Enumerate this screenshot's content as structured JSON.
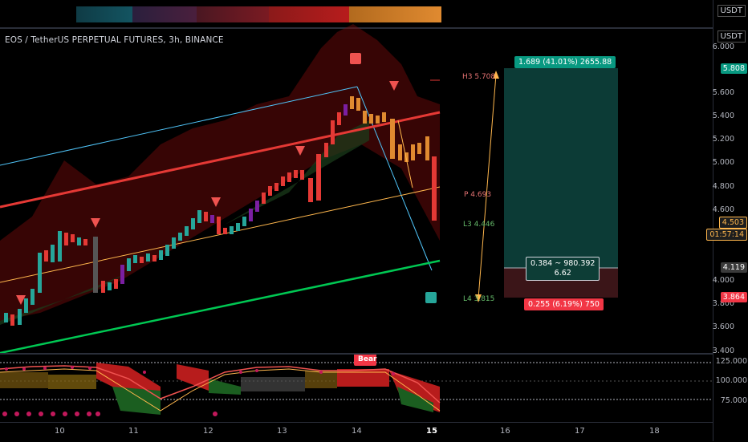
{
  "header": {
    "symbol_title": "EOS / TetherUS PERPETUAL FUTURES, 3h, BINANCE",
    "currency_top": "USDT",
    "currency_main": "USDT"
  },
  "price_axis": {
    "labels": [
      "6.000",
      "5.600",
      "5.400",
      "5.200",
      "5.000",
      "4.800",
      "4.600",
      "4.000",
      "3.800",
      "3.600",
      "3.400"
    ],
    "tags": {
      "target": "5.808",
      "current": "4.503",
      "countdown": "01:57:14",
      "entry": "4.119",
      "stop": "3.864"
    }
  },
  "oscillator_axis": {
    "labels": [
      "125.000",
      "100.000",
      "75.000"
    ]
  },
  "time_axis": {
    "labels": [
      "10",
      "11",
      "12",
      "13",
      "14",
      "15",
      "16",
      "17",
      "18"
    ]
  },
  "pivot_levels": {
    "h3": "H3 5.708",
    "p": "P 4.693",
    "l3": "L3 4.446",
    "l4": "L4 3.815"
  },
  "position_tool": {
    "target_label": "1.689 (41.01%) 2655.88",
    "middle_label_line1": "0.384 ~ 980.392",
    "middle_label_line2": "6.62",
    "stop_label": "0.255 (6.19%) 750"
  },
  "oscillator": {
    "signal_label": "Bear"
  },
  "colors": {
    "bull": "#26a69a",
    "bear": "#e53935",
    "channel_upper": "#4fc3f7",
    "regression_red": "#e53935",
    "regression_orange": "#ffb74d",
    "regression_green": "#00c853",
    "target_zone": "#0c3b36",
    "stop_zone": "#3b1518"
  }
}
